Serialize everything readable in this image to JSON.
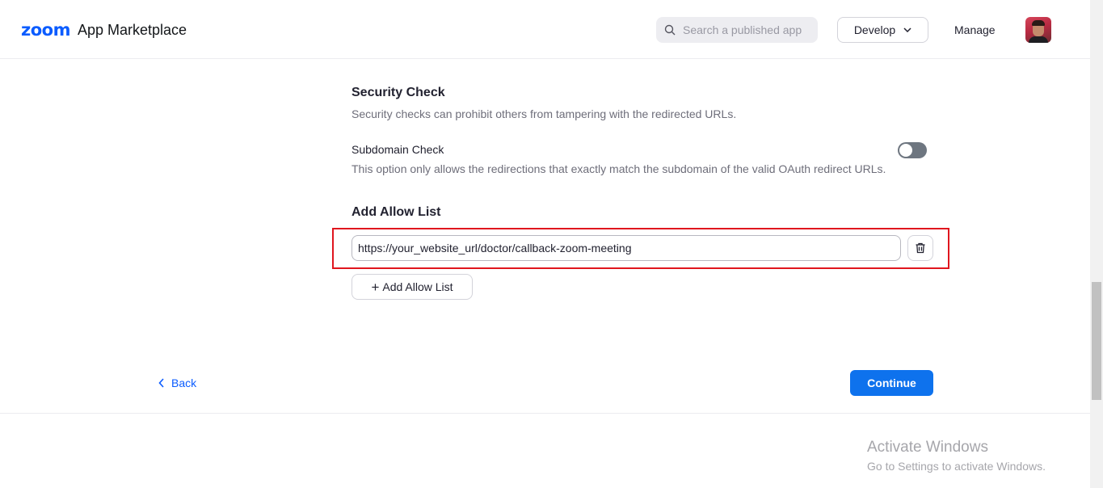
{
  "header": {
    "logo_zoom": "zoom",
    "logo_text": "App Marketplace",
    "search_placeholder": "Search a published app",
    "develop_label": "Develop",
    "manage_label": "Manage"
  },
  "security": {
    "title": "Security Check",
    "description": "Security checks can prohibit others from tampering with the redirected URLs.",
    "subdomain_label": "Subdomain Check",
    "subdomain_enabled": false,
    "subdomain_description": "This option only allows the redirections that exactly match the subdomain of the valid OAuth redirect URLs."
  },
  "allow_list": {
    "title": "Add Allow List",
    "url_value": "https://your_website_url/doctor/callback-zoom-meeting",
    "add_label": "Add Allow List"
  },
  "footer": {
    "back_label": "Back",
    "continue_label": "Continue"
  },
  "watermark": {
    "title": "Activate Windows",
    "subtitle": "Go to Settings to activate Windows."
  },
  "colors": {
    "accent": "#0b5cff",
    "primary_button": "#0e72ed",
    "highlight": "#e0161e"
  }
}
